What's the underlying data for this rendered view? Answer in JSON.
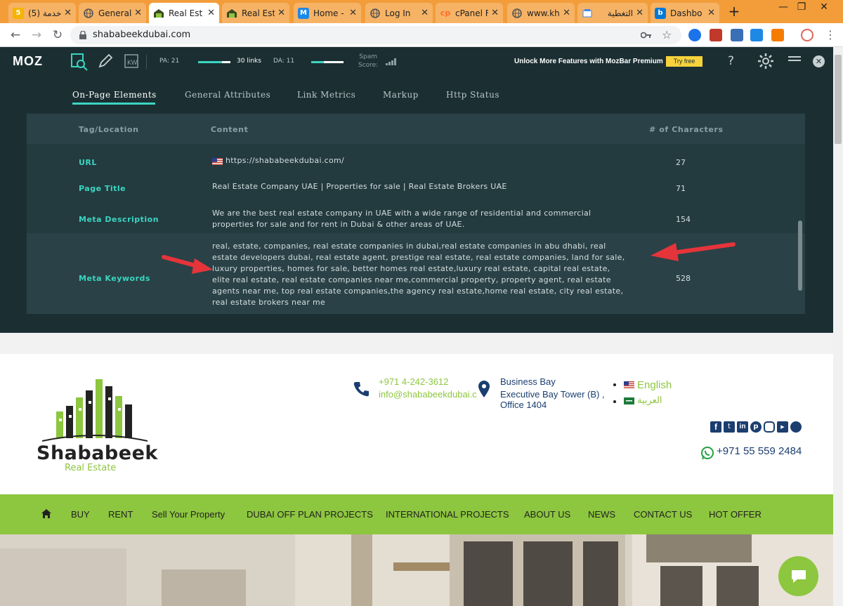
{
  "browser": {
    "tabs": [
      {
        "label": "(5) خدمة",
        "favicon": "5",
        "color": "#f4b400"
      },
      {
        "label": "General",
        "favicon": "globe",
        "color": "#555555"
      },
      {
        "label": "Real Est",
        "favicon": "house",
        "color": "#8dc63f",
        "active": true
      },
      {
        "label": "Real Est",
        "favicon": "house",
        "color": "#8dc63f"
      },
      {
        "label": "Home -",
        "favicon": "M",
        "color": "#1e88e5"
      },
      {
        "label": "Log In",
        "favicon": "globe",
        "color": "#555555"
      },
      {
        "label": "cPanel F",
        "favicon": "cp",
        "color": "#ff6c2c"
      },
      {
        "label": "www.kh",
        "favicon": "globe",
        "color": "#555555"
      },
      {
        "label": "التغطية",
        "favicon": "box",
        "color": "#4285f4"
      },
      {
        "label": "Dashbo",
        "favicon": "b",
        "color": "#0078d7"
      }
    ],
    "url": "shababeekdubai.com"
  },
  "mozbar": {
    "logo": "MOZ",
    "pa": "PA: 21",
    "links": "30 links",
    "da": "DA: 11",
    "spam_line1": "Spam",
    "spam_line2": "Score:",
    "premium": "Unlock More Features with MozBar Premium",
    "try_free": "Try free",
    "pa_fraction": 0.21,
    "da_fraction": 0.11,
    "help": "?"
  },
  "panel": {
    "tabs": [
      "On-Page Elements",
      "General Attributes",
      "Link Metrics",
      "Markup",
      "Http Status"
    ],
    "headers": {
      "tag": "Tag/Location",
      "content": "Content",
      "chars": "# of Characters"
    },
    "rows": [
      {
        "tag": "URL",
        "content": "https://shababeekdubai.com/",
        "chars": "27"
      },
      {
        "tag": "Page Title",
        "content": "Real Estate Company UAE | Properties for sale | Real Estate Brokers UAE",
        "chars": "71"
      },
      {
        "tag": "Meta Description",
        "content_lines": [
          "We are the best real estate company in UAE with a wide range of residential and commercial",
          "properties for sale and for rent in Dubai & other areas of UAE."
        ],
        "chars": "154"
      },
      {
        "tag": "Meta Keywords",
        "content_lines": [
          "real, estate, companies, real estate companies in dubai,real estate companies in abu dhabi, real",
          "estate developers dubai, real estate agent, prestige real estate, real estate companies, land for sale,",
          "luxury properties, homes for sale, better homes real estate,luxury real estate, capital real estate,",
          "elite real estate, real estate companies near me,commercial property, property agent, real estate",
          "agents near me, top real estate companies,the agency real estate,home real estate, city real estate,",
          "real estate brokers near me"
        ],
        "chars": "528"
      }
    ]
  },
  "site": {
    "brand": "Shababeek",
    "brand_sub": "Real Estate",
    "phone": "+971 4-242-3612",
    "email": "info@shababeekdubai.c",
    "address": [
      "Business Bay",
      "Executive Bay Tower (B) ,",
      "Office 1404"
    ],
    "lang_en": "English",
    "lang_ar": "العربية",
    "whatsapp": "+971 55 559 2484",
    "nav": [
      "BUY",
      "RENT",
      "Sell Your Property",
      "DUBAI OFF PLAN PROJECTS",
      "INTERNATIONAL PROJECTS",
      "ABOUT US",
      "NEWS",
      "CONTACT US",
      "HOT OFFER"
    ],
    "colors": {
      "green": "#8dc63f",
      "navy": "#1b3e6f"
    }
  }
}
